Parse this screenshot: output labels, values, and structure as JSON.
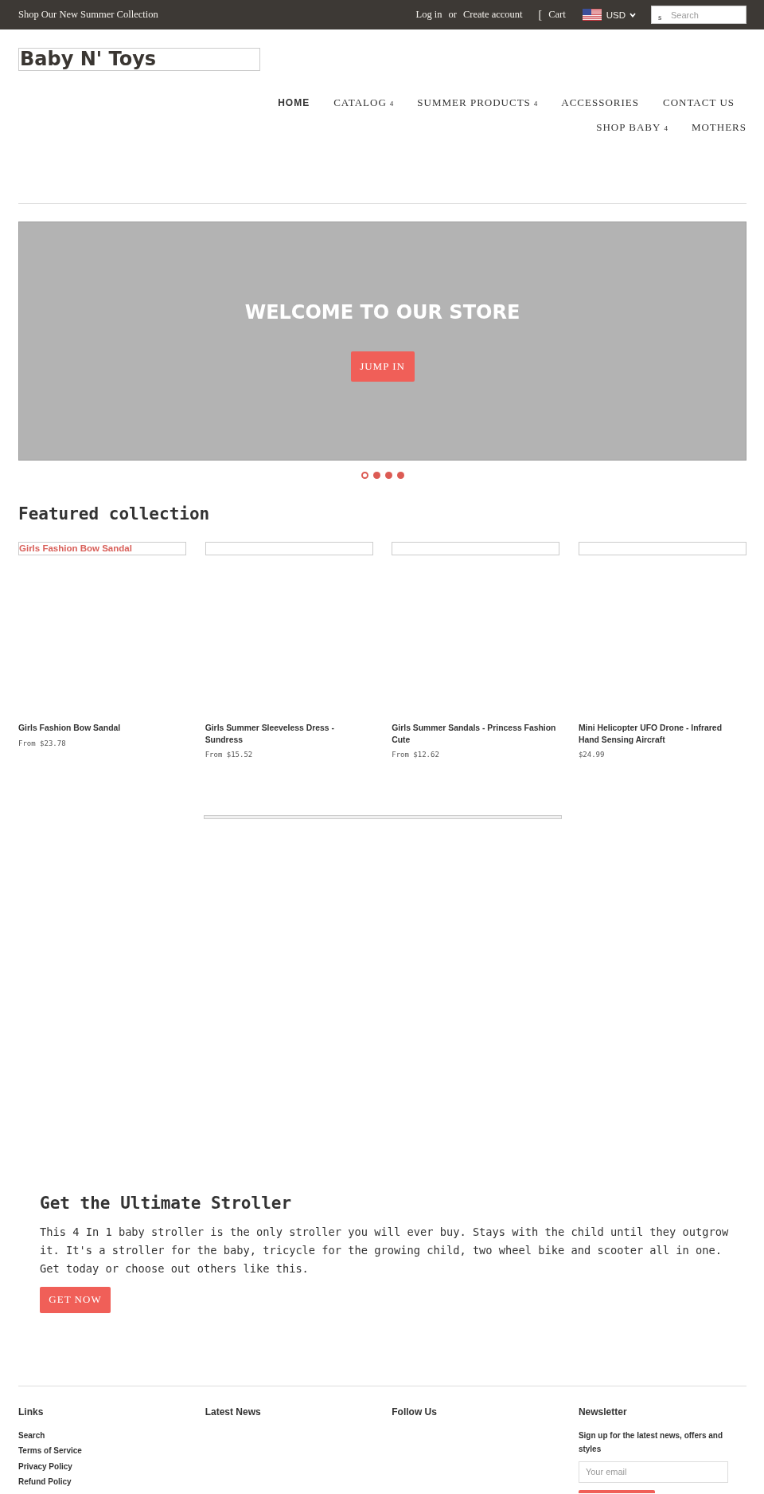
{
  "top_bar": {
    "announcement": "Shop Our New Summer Collection",
    "login_link": "Log in",
    "separator": "or",
    "create_account_link": "Create account",
    "cart_glyph": "[",
    "cart_link": "Cart",
    "currency": "USD",
    "search": {
      "glyph": "s",
      "placeholder": "Search"
    }
  },
  "header": {
    "logo": "Baby N' Toys",
    "nav": [
      {
        "label": "HOME",
        "selected": true
      },
      {
        "label": "CATALOG",
        "dropdown_glyph": "4",
        "selected": false
      },
      {
        "label": "SUMMER PRODUCTS",
        "dropdown_glyph": "4",
        "selected": false
      },
      {
        "label": "ACCESSORIES",
        "selected": false
      },
      {
        "label": "CONTACT US",
        "selected": false
      },
      {
        "label": "SHOP BABY",
        "dropdown_glyph": "4",
        "selected": false
      },
      {
        "label": "MOTHERS",
        "selected": false
      }
    ]
  },
  "hero": {
    "title": "WELCOME TO OUR STORE",
    "button": "JUMP IN",
    "slides": [
      {
        "selected": true
      },
      {
        "selected": false
      },
      {
        "selected": false
      },
      {
        "selected": false
      }
    ]
  },
  "featured": {
    "title": "Featured collection",
    "products": [
      {
        "image_alt": "Girls Fashion Bow Sandal",
        "title": "Girls Fashion Bow Sandal",
        "price": "From $23.78"
      },
      {
        "title": "Girls Summer Sleeveless Dress - Sundress",
        "price": "From $15.52"
      },
      {
        "title": "Girls Summer Sandals - Princess Fashion Cute",
        "price": "From $12.62"
      },
      {
        "title": "Mini Helicopter UFO Drone - Infrared Hand Sensing Aircraft",
        "price": "$24.99"
      }
    ]
  },
  "promo": {
    "title": "Get the Ultimate Stroller",
    "text": "This 4 In 1 baby stroller is the only stroller you will ever buy. Stays with the child until they outgrow it. It's a stroller for the baby, tricycle for the growing child, two wheel bike and scooter all in one. Get today or choose out others like this.",
    "button": "GET NOW"
  },
  "footer": {
    "columns": [
      {
        "kind": "links",
        "title": "Links",
        "links": [
          "Search",
          "Terms of Service",
          "Privacy Policy",
          "Refund Policy"
        ]
      },
      {
        "kind": "heading",
        "title": "Latest News"
      },
      {
        "kind": "heading",
        "title": "Follow Us"
      },
      {
        "kind": "newsletter",
        "title": "Newsletter",
        "text": "Sign up for the latest news, offers and styles",
        "email_placeholder": "Your email"
      }
    ]
  }
}
